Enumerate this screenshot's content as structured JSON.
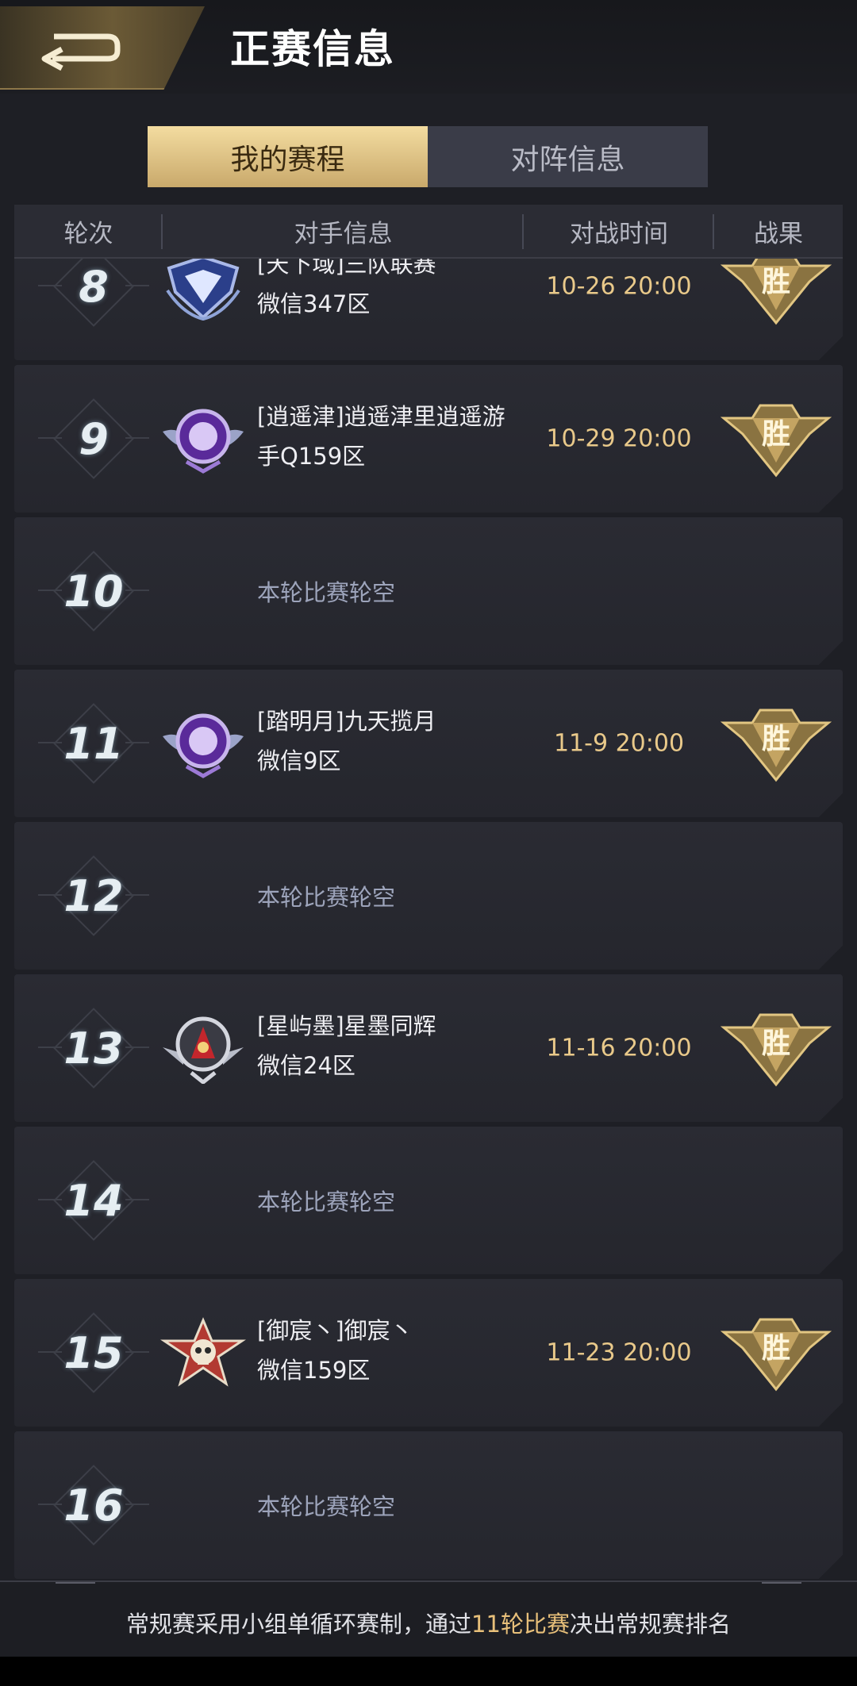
{
  "header": {
    "title": "正赛信息"
  },
  "tabs": [
    {
      "label": "我的赛程",
      "active": true
    },
    {
      "label": "对阵信息",
      "active": false
    }
  ],
  "table": {
    "columns": [
      "轮次",
      "对手信息",
      "对战时间",
      "战果"
    ]
  },
  "rows": [
    {
      "round": "8",
      "name": "[天下域]三队联赛",
      "server": "微信347区",
      "time": "10-26 20:00",
      "result": "胜",
      "badge": "blue-shield-badge"
    },
    {
      "round": "9",
      "name": "[逍遥津]逍遥津里逍遥游",
      "server": "手Q159区",
      "time": "10-29 20:00",
      "result": "胜",
      "badge": "purple-wing-badge"
    },
    {
      "round": "10",
      "bye": "本轮比赛轮空"
    },
    {
      "round": "11",
      "name": "[踏明月]九天揽月",
      "server": "微信9区",
      "time": "11-9 20:00",
      "result": "胜",
      "badge": "purple-wing-badge"
    },
    {
      "round": "12",
      "bye": "本轮比赛轮空"
    },
    {
      "round": "13",
      "name": "[星屿墨]星墨同辉",
      "server": "微信24区",
      "time": "11-16 20:00",
      "result": "胜",
      "badge": "red-hood-badge"
    },
    {
      "round": "14",
      "bye": "本轮比赛轮空"
    },
    {
      "round": "15",
      "name": "[御宸丶]御宸丶",
      "server": "微信159区",
      "time": "11-23 20:00",
      "result": "胜",
      "badge": "skull-star-badge"
    },
    {
      "round": "16",
      "bye": "本轮比赛轮空"
    }
  ],
  "footer": {
    "prefix": "常规赛采用小组单循环赛制，通过",
    "highlight": "11轮比赛",
    "suffix": "决出常规赛排名"
  },
  "colors": {
    "accent_gold": "#e9c98a",
    "background": "#1e1f25"
  }
}
